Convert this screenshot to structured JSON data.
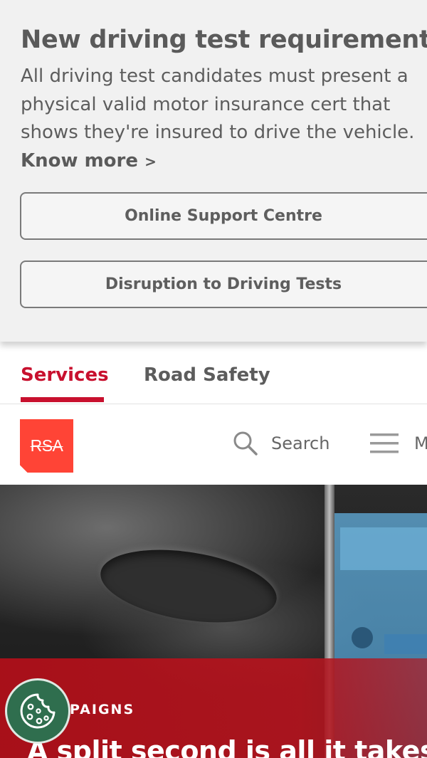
{
  "notice": {
    "title": "New driving test requirements",
    "text": "All driving test candidates must present a physical valid motor insurance cert that shows they're insured to drive the vehicle.",
    "link_label": "Know more",
    "link_arrow": ">"
  },
  "buttons": {
    "online_support": "Online Support Centre",
    "disruption": "Disruption to Driving Tests"
  },
  "tabs": [
    {
      "label": "Services",
      "active": true
    },
    {
      "label": "Road Safety",
      "active": false
    }
  ],
  "header": {
    "logo_text": "RSA",
    "search_label": "Search",
    "menu_label": "M",
    "icons": {
      "search": "search-icon",
      "menu": "hamburger-menu-icon"
    }
  },
  "hero": {
    "kicker": "PAIGNS",
    "headline": "A split second is all it takes."
  },
  "cookie": {
    "icon": "cookie-icon"
  },
  "colors": {
    "accent_red": "#c8102e",
    "logo_red": "#ff4436",
    "notice_bg": "#f1f1f1",
    "cookie_green": "#2f6e4e"
  }
}
